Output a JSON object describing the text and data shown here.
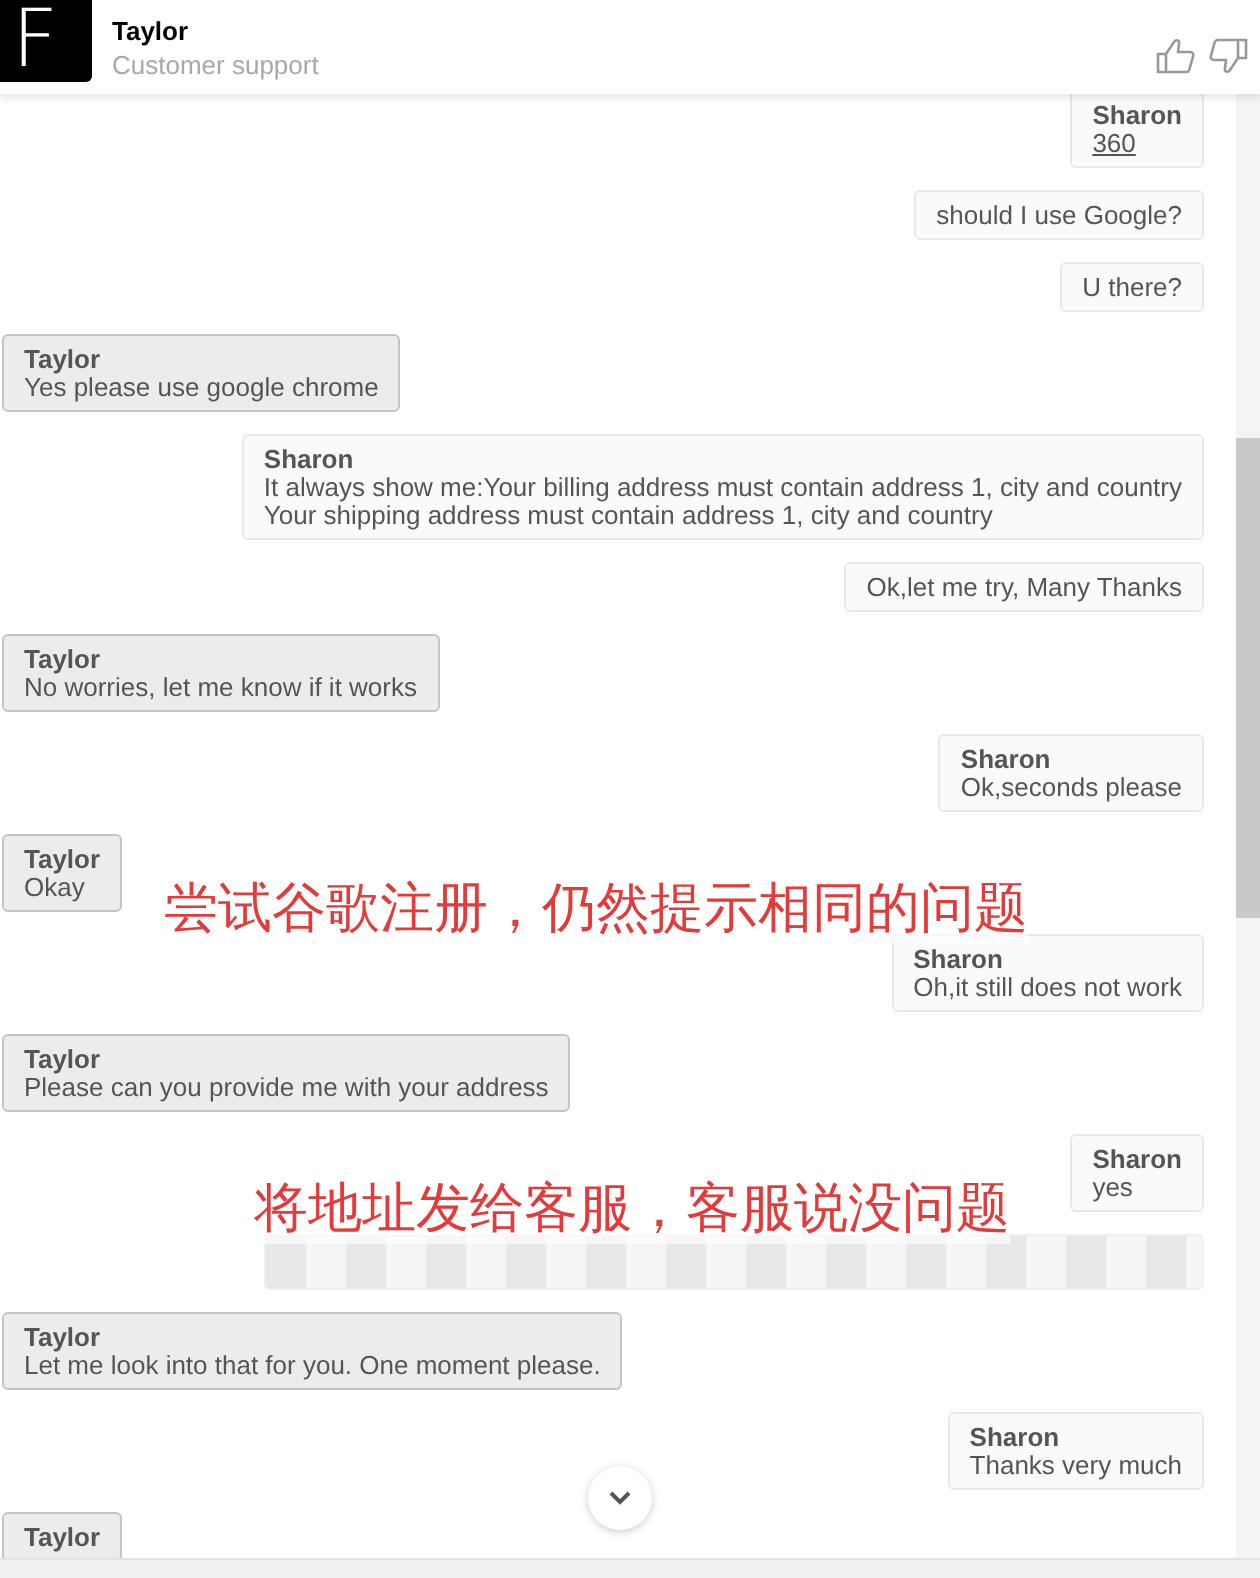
{
  "header": {
    "logo": "F",
    "title": "Taylor",
    "subtitle": "Customer support"
  },
  "messages": [
    {
      "kind": "link",
      "outgoing": true,
      "sender": "Sharon",
      "lines": [
        "360"
      ]
    },
    {
      "kind": "text",
      "outgoing": true,
      "lines": [
        "should I use Google?"
      ]
    },
    {
      "kind": "text",
      "outgoing": true,
      "lines": [
        "U there?"
      ]
    },
    {
      "kind": "text",
      "outgoing": false,
      "sender": "Taylor",
      "lines": [
        "Yes please use google chrome"
      ]
    },
    {
      "kind": "text",
      "outgoing": true,
      "sender": "Sharon",
      "lines": [
        "It always show me:Your billing address must contain address 1, city and country",
        "Your shipping address must contain address 1, city and country"
      ]
    },
    {
      "kind": "text",
      "outgoing": true,
      "lines": [
        "Ok,let me try, Many Thanks"
      ]
    },
    {
      "kind": "text",
      "outgoing": false,
      "sender": "Taylor",
      "lines": [
        "No worries, let me know if it works"
      ]
    },
    {
      "kind": "text",
      "outgoing": true,
      "sender": "Sharon",
      "lines": [
        "Ok,seconds please"
      ]
    },
    {
      "kind": "text",
      "outgoing": false,
      "sender": "Taylor",
      "lines": [
        "Okay"
      ]
    },
    {
      "kind": "text",
      "outgoing": true,
      "sender": "Sharon",
      "lines": [
        "Oh,it still does not work"
      ]
    },
    {
      "kind": "text",
      "outgoing": false,
      "sender": "Taylor",
      "lines": [
        "Please can you provide me with your address"
      ]
    },
    {
      "kind": "text",
      "outgoing": true,
      "sender": "Sharon",
      "lines": [
        "yes"
      ]
    },
    {
      "kind": "blurred",
      "outgoing": true
    },
    {
      "kind": "text",
      "outgoing": false,
      "sender": "Taylor",
      "lines": [
        "Let me look into that for you. One moment please."
      ]
    },
    {
      "kind": "text",
      "outgoing": true,
      "sender": "Sharon",
      "lines": [
        "Thanks very much"
      ]
    },
    {
      "kind": "text",
      "outgoing": false,
      "sender": "Taylor"
    }
  ],
  "annotations": [
    "尝试谷歌注册，仍然提示相同的问题",
    "将地址发给客服，客服说没问题"
  ]
}
